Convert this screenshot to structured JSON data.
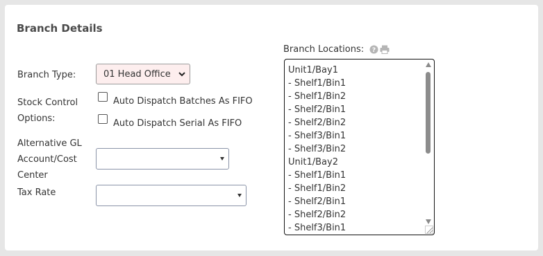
{
  "panel": {
    "title": "Branch Details"
  },
  "branch_type": {
    "label": "Branch Type:",
    "selected": "01 Head Office"
  },
  "stock_control": {
    "label_line1": "Stock Control",
    "label_line2": "Options:",
    "options": [
      {
        "label": "Auto Dispatch Batches As FIFO",
        "checked": false
      },
      {
        "label": "Auto Dispatch Serial As FIFO",
        "checked": false
      }
    ]
  },
  "alt_gl": {
    "label_line1": "Alternative GL",
    "label_line2": "Account/Cost",
    "label_line3": "Center",
    "selected": ""
  },
  "tax_rate": {
    "label": "Tax Rate",
    "selected": ""
  },
  "branch_locations": {
    "label": "Branch Locations:",
    "items": [
      "Unit1/Bay1",
      "- Shelf1/Bin1",
      "- Shelf1/Bin2",
      "- Shelf2/Bin1",
      "- Shelf2/Bin2",
      "- Shelf3/Bin1",
      "- Shelf3/Bin2",
      "Unit1/Bay2",
      "- Shelf1/Bin1",
      "- Shelf1/Bin2",
      "- Shelf2/Bin1",
      "- Shelf2/Bin2",
      "- Shelf3/Bin1"
    ]
  },
  "icons": {
    "help": "help-icon",
    "print": "print-icon"
  },
  "colors": {
    "select_bg": "#fdeeee",
    "panel_bg": "#ffffff",
    "page_bg": "#e6e6e6"
  }
}
